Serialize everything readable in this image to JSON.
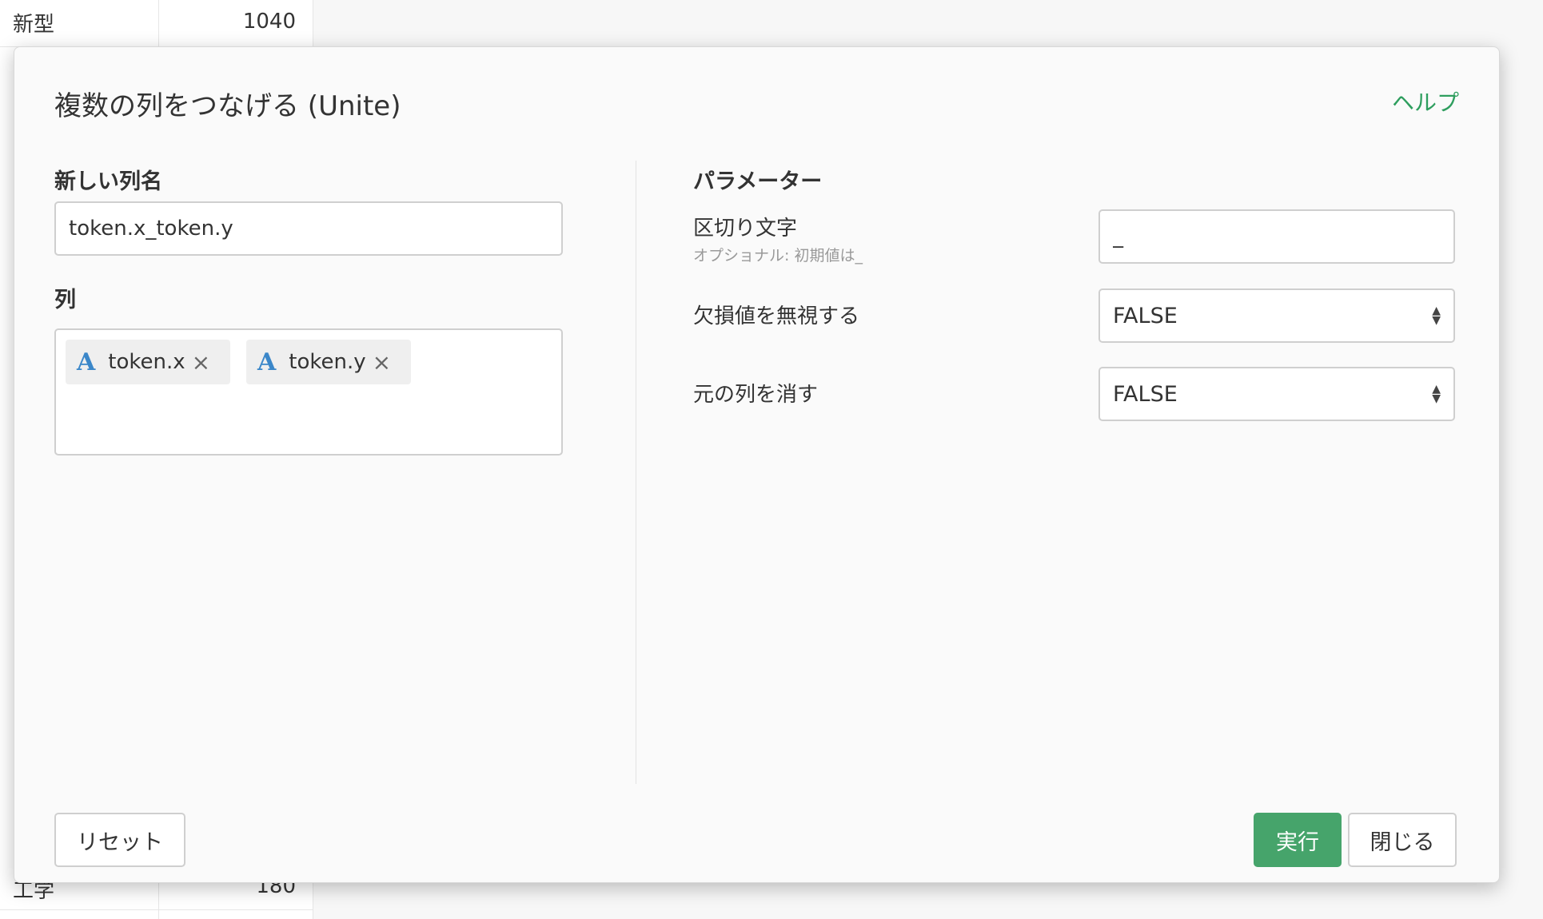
{
  "background_table": {
    "top_row": {
      "name": "新型",
      "value": "1040"
    },
    "bottom_row": {
      "name": "工学",
      "value": "180"
    }
  },
  "dialog": {
    "title": "複数の列をつなげる (Unite)",
    "help_link": "ヘルプ",
    "new_column": {
      "label": "新しい列名",
      "value": "token.x_token.y"
    },
    "columns": {
      "label": "列",
      "tags": [
        {
          "type_icon": "A",
          "name": "token.x",
          "remove_icon": "×"
        },
        {
          "type_icon": "A",
          "name": "token.y",
          "remove_icon": "×"
        }
      ]
    },
    "parameters": {
      "heading": "パラメーター",
      "separator": {
        "label": "区切り文字",
        "sub": "オプショナル: 初期値は_",
        "value": "_"
      },
      "ignore_na": {
        "label": "欠損値を無視する",
        "value": "FALSE"
      },
      "remove_original": {
        "label": "元の列を消す",
        "value": "FALSE"
      }
    },
    "buttons": {
      "reset": "リセット",
      "run": "実行",
      "close": "閉じる"
    },
    "colors": {
      "accent": "#46a46b",
      "link": "#2e9e5e",
      "type_icon": "#3b87c9"
    }
  }
}
